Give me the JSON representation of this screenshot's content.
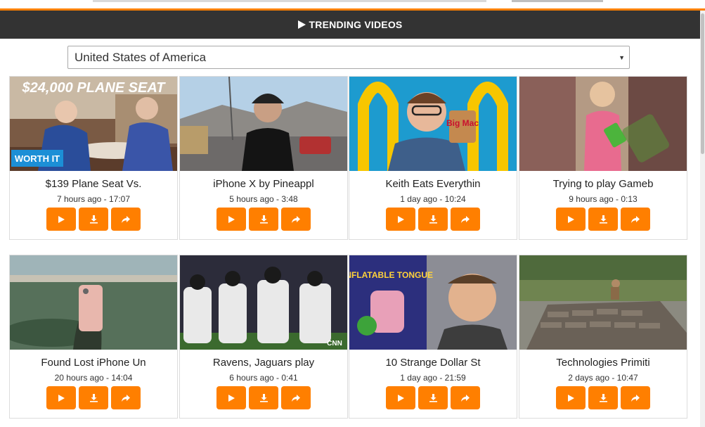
{
  "header": {
    "title": "TRENDING VIDEOS",
    "icon": "play-icon"
  },
  "country_select": {
    "selected": "United States of America"
  },
  "colors": {
    "accent": "#ff7f00",
    "header_bg": "#333333"
  },
  "videos": [
    {
      "title": "$139 Plane Seat Vs.",
      "meta": "7 hours ago - 17:07",
      "thumb_text": "$24,000 PLANE SEAT",
      "badge": "WORTH IT"
    },
    {
      "title": "iPhone X by Pineappl",
      "meta": "5 hours ago - 3:48"
    },
    {
      "title": "Keith Eats Everythin",
      "meta": "1 day ago - 10:24",
      "thumb_text": "Big Mac"
    },
    {
      "title": "Trying to play Gameb",
      "meta": "9 hours ago - 0:13"
    },
    {
      "title": "Found Lost iPhone Un",
      "meta": "20 hours ago - 14:04"
    },
    {
      "title": "Ravens, Jaguars play",
      "meta": "6 hours ago - 0:41",
      "thumb_text": "CNN"
    },
    {
      "title": "10 Strange Dollar St",
      "meta": "1 day ago - 21:59",
      "thumb_text": "INFLATABLE TONGUE"
    },
    {
      "title": "Technologies Primiti",
      "meta": "2 days ago - 10:47"
    }
  ]
}
